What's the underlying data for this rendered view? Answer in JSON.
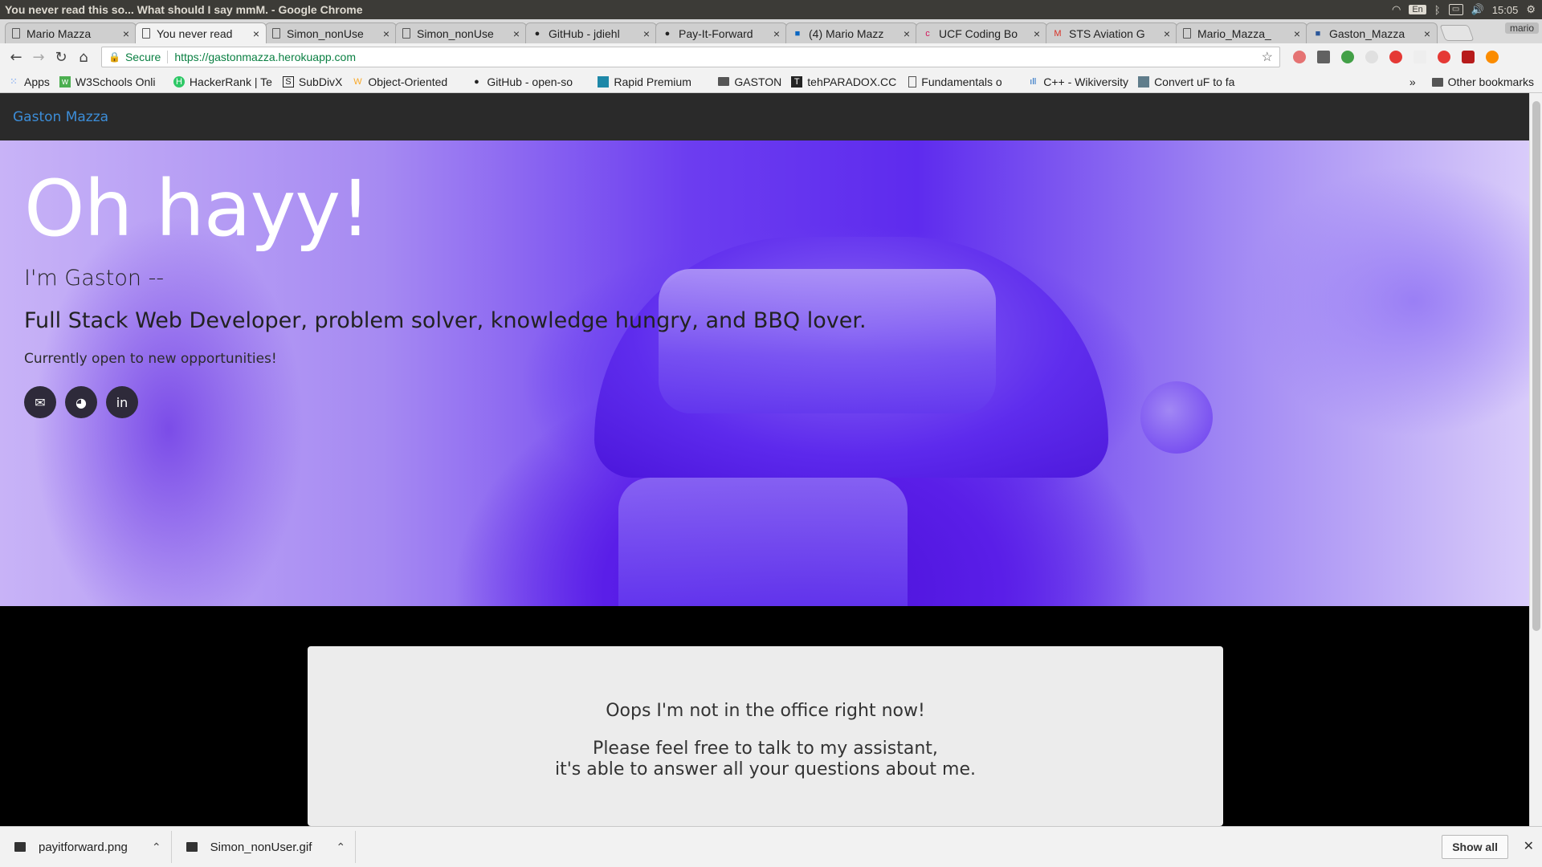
{
  "os": {
    "window_title": "You never read this so... What should I say mmM. - Google Chrome",
    "lang": "En",
    "time": "15:05"
  },
  "tabs": [
    {
      "label": "Mario Mazza",
      "icon": "page-icon"
    },
    {
      "label": "You never read",
      "icon": "page-icon",
      "active": true
    },
    {
      "label": "Simon_nonUse",
      "icon": "page-icon"
    },
    {
      "label": "Simon_nonUse",
      "icon": "page-icon"
    },
    {
      "label": "GitHub - jdiehl",
      "icon": "github-icon"
    },
    {
      "label": "Pay-It-Forward",
      "icon": "github-icon"
    },
    {
      "label": "(4) Mario Mazz",
      "icon": "linkedin-icon"
    },
    {
      "label": "UCF Coding Bo",
      "icon": "ucf-icon"
    },
    {
      "label": "STS Aviation G",
      "icon": "gmail-icon"
    },
    {
      "label": "Mario_Mazza_",
      "icon": "page-icon"
    },
    {
      "label": "Gaston_Mazza",
      "icon": "word-icon"
    }
  ],
  "profile_name": "mario",
  "omnibox": {
    "secure_label": "Secure",
    "url": "https://gastonmazza.herokuapp.com"
  },
  "bookmarks": [
    {
      "label": "Apps",
      "icon": "apps-grid-icon"
    },
    {
      "label": "W3Schools Onli",
      "icon": "w3schools-icon"
    },
    {
      "label": "HackerRank | Te",
      "icon": "hackerrank-icon"
    },
    {
      "label": "SubDivX",
      "icon": "subdivx-icon"
    },
    {
      "label": "Object-Oriented",
      "icon": "bookmark-icon"
    },
    {
      "label": "GitHub - open-so",
      "icon": "github-icon"
    },
    {
      "label": "Rapid Premium",
      "icon": "rapid-icon"
    },
    {
      "label": "GASTON",
      "icon": "folder-icon"
    },
    {
      "label": "tehPARADOX.CC",
      "icon": "tehparadox-icon"
    },
    {
      "label": "Fundamentals o",
      "icon": "page-icon"
    },
    {
      "label": "C++ - Wikiversity",
      "icon": "wikiversity-icon"
    },
    {
      "label": "Convert uF to fa",
      "icon": "convert-icon"
    }
  ],
  "bookmarks_overflow": "»",
  "other_bookmarks": "Other bookmarks",
  "site": {
    "brand": "Gaston Mazza",
    "hero_title": "Oh hayy!",
    "hero_sub1": "I'm Gaston --",
    "hero_sub2": "Full Stack Web Developer, problem solver, knowledge hungry, and BBQ lover.",
    "hero_sub3": "Currently open to new opportunities!",
    "social": [
      {
        "name": "email-icon",
        "glyph": "✉"
      },
      {
        "name": "github-icon",
        "glyph": "◕"
      },
      {
        "name": "linkedin-icon",
        "glyph": "in"
      }
    ],
    "chat_line1": "Oops I'm not in the office right now!",
    "chat_line2": "Please feel free to talk to my assistant,",
    "chat_line3": "it's able to answer all your questions about me."
  },
  "downloads": [
    {
      "file": "payitforward.png"
    },
    {
      "file": "Simon_nonUser.gif"
    }
  ],
  "show_all": "Show all"
}
